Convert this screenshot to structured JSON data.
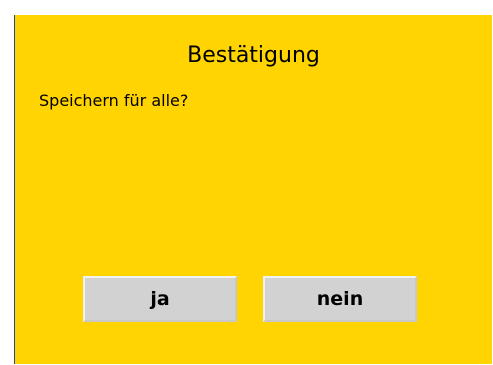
{
  "dialog": {
    "title": "Bestätigung",
    "message": "Speichern für alle?",
    "yes_label": "ja",
    "no_label": "nein",
    "colors": {
      "background": "#ffd400",
      "button": "#d2d2d2"
    }
  }
}
